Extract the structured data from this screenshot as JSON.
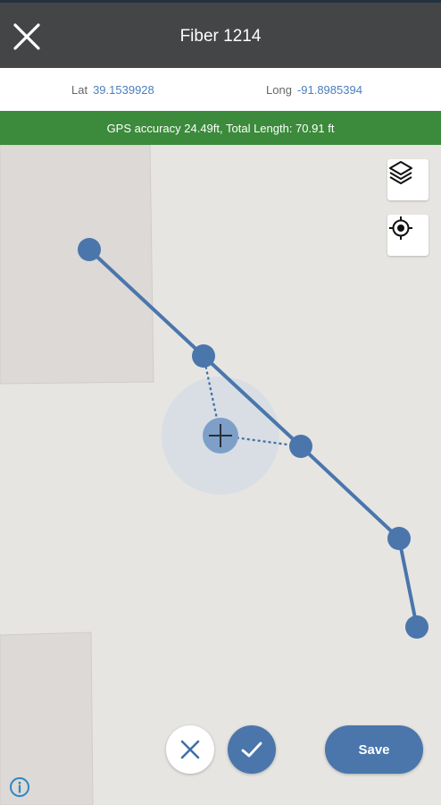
{
  "header": {
    "title": "Fiber 1214",
    "close_icon": "close-icon"
  },
  "coordinates": {
    "lat_label": "Lat",
    "lat_value": "39.1539928",
    "long_label": "Long",
    "long_value": "-91.8985394"
  },
  "status": {
    "text": "GPS accuracy 24.49ft, Total Length: 70.91 ft",
    "color": "#3c8a3b"
  },
  "map": {
    "line_color": "#4a76ac",
    "vertex_count": 6,
    "layers_icon": "layers-icon",
    "locate_icon": "gps-locate-icon",
    "crosshair_icon": "crosshair-icon"
  },
  "actions": {
    "cancel_icon": "close-icon",
    "confirm_icon": "check-icon",
    "save_label": "Save",
    "info_icon": "info-icon"
  }
}
